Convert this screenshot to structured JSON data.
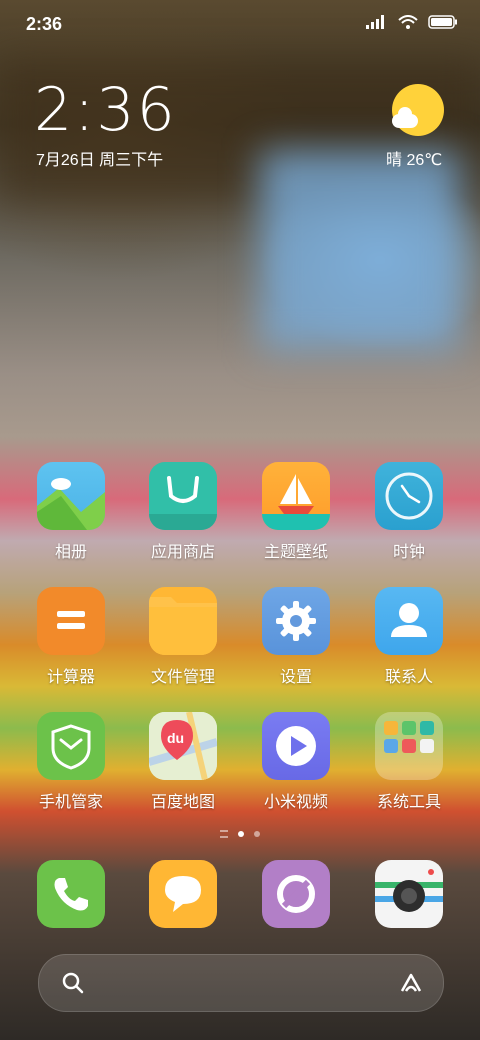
{
  "status_bar": {
    "time": "2:36"
  },
  "lock_widget": {
    "clock": "2:36",
    "date": "7月26日 周三下午",
    "weather": "晴 26℃"
  },
  "apps": [
    {
      "label": "相册",
      "icon": "gallery-icon"
    },
    {
      "label": "应用商店",
      "icon": "app-store-icon"
    },
    {
      "label": "主题壁纸",
      "icon": "themes-icon"
    },
    {
      "label": "时钟",
      "icon": "clock-icon"
    },
    {
      "label": "计算器",
      "icon": "calculator-icon"
    },
    {
      "label": "文件管理",
      "icon": "file-manager-icon"
    },
    {
      "label": "设置",
      "icon": "settings-icon"
    },
    {
      "label": "联系人",
      "icon": "contacts-icon"
    },
    {
      "label": "手机管家",
      "icon": "security-icon"
    },
    {
      "label": "百度地图",
      "icon": "baidu-maps-icon",
      "badge_text": "du"
    },
    {
      "label": "小米视频",
      "icon": "video-icon"
    },
    {
      "label": "系统工具",
      "icon": "system-tools-folder-icon"
    }
  ],
  "dock": [
    {
      "icon": "phone-icon"
    },
    {
      "icon": "messages-icon"
    },
    {
      "icon": "browser-icon"
    },
    {
      "icon": "camera-icon"
    }
  ],
  "page_indicator": {
    "pages": 2,
    "active": 1
  }
}
